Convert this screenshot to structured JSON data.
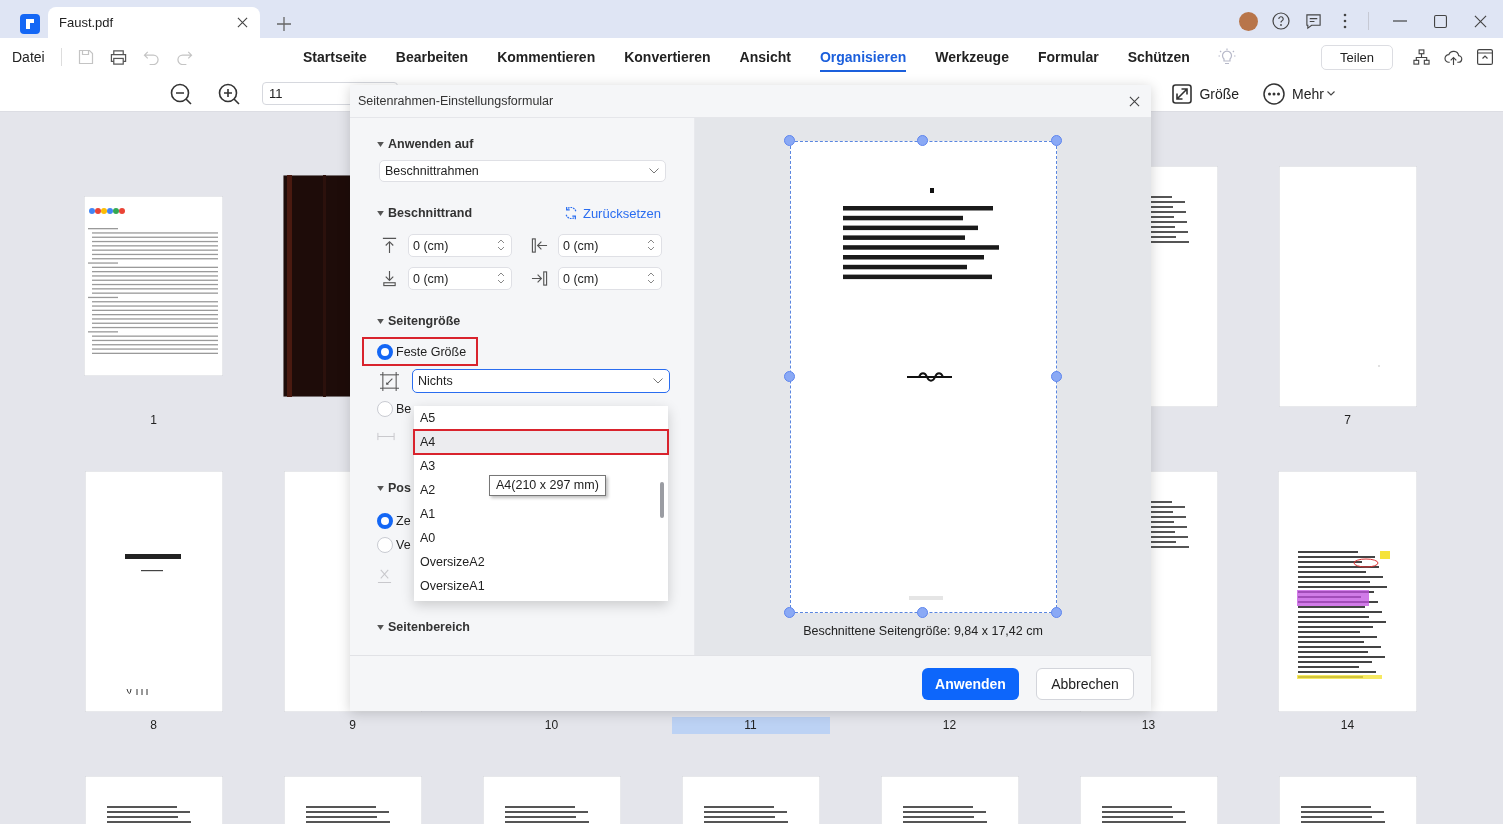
{
  "app_tab": {
    "title": "Faust.pdf"
  },
  "menu": {
    "file": "Datei",
    "tabs": [
      {
        "label": "Startseite",
        "selected": false
      },
      {
        "label": "Bearbeiten",
        "selected": false
      },
      {
        "label": "Kommentieren",
        "selected": false
      },
      {
        "label": "Konvertieren",
        "selected": false
      },
      {
        "label": "Ansicht",
        "selected": false
      },
      {
        "label": "Organisieren",
        "selected": true
      },
      {
        "label": "Werkzeuge",
        "selected": false
      },
      {
        "label": "Formular",
        "selected": false
      },
      {
        "label": "Schützen",
        "selected": false
      }
    ],
    "share": "Teilen"
  },
  "toolbar": {
    "page_number": "11",
    "tools": [
      {
        "label": "Größe",
        "kind": "resize"
      },
      {
        "label": "Mehr",
        "kind": "more"
      }
    ]
  },
  "pages": [
    {
      "kind": "letter",
      "label": "1",
      "selected": false
    },
    {
      "kind": "cover"
    },
    {
      "kind": "hidden"
    },
    {
      "kind": "hidden"
    },
    {
      "kind": "hidden"
    },
    {
      "kind": "poem"
    },
    {
      "kind": "blank",
      "label": "7",
      "selected": false
    },
    {
      "kind": "dedication",
      "label": "8",
      "selected": false
    },
    {
      "kind": "blank",
      "label": "9",
      "selected": false
    },
    {
      "kind": "hidden",
      "label": "10",
      "selected": false
    },
    {
      "kind": "hidden",
      "label": "11",
      "selected": true
    },
    {
      "kind": "hidden",
      "label": "12",
      "selected": false
    },
    {
      "kind": "poem",
      "label": "13",
      "selected": false
    },
    {
      "kind": "annotated",
      "label": "14",
      "selected": false
    },
    {
      "kind": "poem"
    },
    {
      "kind": "poem"
    },
    {
      "kind": "poem"
    },
    {
      "kind": "poem"
    },
    {
      "kind": "poem"
    },
    {
      "kind": "poem"
    },
    {
      "kind": "poem"
    }
  ],
  "dialog": {
    "title": "Seitenrahmen-Einstellungsformular",
    "apply_to": {
      "heading": "Anwenden auf",
      "value": "Beschnittrahmen"
    },
    "margins": {
      "heading": "Beschnittrand",
      "reset": "Zurücksetzen",
      "fields": [
        {
          "kind": "top",
          "value": "0 (cm)"
        },
        {
          "kind": "left",
          "value": "0 (cm)"
        },
        {
          "kind": "bottom",
          "value": "0 (cm)"
        },
        {
          "kind": "right",
          "value": "0 (cm)"
        }
      ]
    },
    "page_size": {
      "heading": "Seitengröße",
      "options": [
        {
          "label": "Feste Größe",
          "selected": true,
          "highlighted": true
        },
        {
          "label": "Be",
          "selected": false,
          "highlighted": false
        }
      ],
      "size_select": {
        "value": "Nichts",
        "expanded": true
      },
      "size_list": [
        {
          "label": "A5",
          "hovered": false,
          "highlighted": false
        },
        {
          "label": "A4",
          "hovered": true,
          "highlighted": true
        },
        {
          "label": "A3",
          "hovered": false,
          "highlighted": false
        },
        {
          "label": "A2",
          "hovered": false,
          "highlighted": false
        },
        {
          "label": "A1",
          "hovered": false,
          "highlighted": false
        },
        {
          "label": "A0",
          "hovered": false,
          "highlighted": false
        },
        {
          "label": "OversizeA2",
          "hovered": false,
          "highlighted": false
        },
        {
          "label": "OversizeA1",
          "hovered": false,
          "highlighted": false
        }
      ],
      "tooltip": "A4(210 x 297 mm)"
    },
    "position": {
      "heading": "Pos",
      "options": [
        {
          "label": "Ze",
          "selected": true
        },
        {
          "label": "Ve",
          "selected": false
        }
      ]
    },
    "page_range": {
      "heading": "Seitenbereich"
    },
    "preview": {
      "caption": "Beschnittene Seitengröße: 9,84 x 17,42 cm"
    },
    "buttons": [
      {
        "label": "Anwenden",
        "kind": "primary"
      },
      {
        "label": "Abbrechen",
        "kind": "secondary"
      }
    ]
  }
}
